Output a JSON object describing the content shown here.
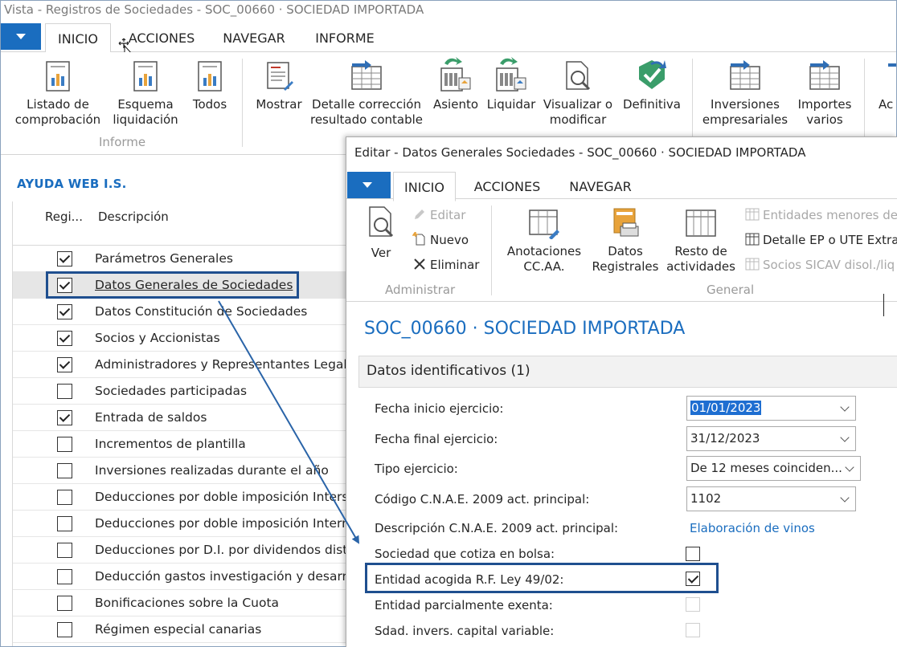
{
  "main_window": {
    "title": "Vista - Registros de Sociedades - SOC_00660 · SOCIEDAD IMPORTADA",
    "tabs": [
      "INICIO",
      "ACCIONES",
      "NAVEGAR",
      "INFORME"
    ],
    "ribbon": {
      "buttons": [
        {
          "label": "Listado de\ncomprobación",
          "icon": "report-chart-icon"
        },
        {
          "label": "Esquema\nliquidación",
          "icon": "report-chart-icon"
        },
        {
          "label": "Todos",
          "icon": "report-chart-icon"
        },
        {
          "label": "Mostrar",
          "icon": "document-edit-icon"
        },
        {
          "label": "Detalle corrección\nresultado contable",
          "icon": "table-arrow-icon"
        },
        {
          "label": "Asiento",
          "icon": "post-document-icon"
        },
        {
          "label": "Liquidar",
          "icon": "post-document-icon"
        },
        {
          "label": "Visualizar o\nmodificar",
          "icon": "preview-document-icon"
        },
        {
          "label": "Definitiva",
          "icon": "green-check-icon"
        },
        {
          "label": "Inversiones\nempresariales",
          "icon": "table-arrow-icon"
        },
        {
          "label": "Importes\nvarios",
          "icon": "table-arrow-icon"
        },
        {
          "label": "Ac",
          "icon": "table-arrow-icon"
        }
      ],
      "group_label": "Informe"
    },
    "section_title": "AYUDA WEB I.S.",
    "list": {
      "columns": [
        "Regi...",
        "Descripción"
      ],
      "rows": [
        {
          "checked": true,
          "label": "Parámetros Generales"
        },
        {
          "checked": true,
          "label": "Datos Generales de Sociedades"
        },
        {
          "checked": true,
          "label": "Datos Constitución de Sociedades"
        },
        {
          "checked": true,
          "label": "Socios y Accionistas"
        },
        {
          "checked": true,
          "label": "Administradores y Representantes Legales"
        },
        {
          "checked": false,
          "label": "Sociedades participadas"
        },
        {
          "checked": true,
          "label": "Entrada de saldos"
        },
        {
          "checked": false,
          "label": "Incrementos de plantilla"
        },
        {
          "checked": false,
          "label": "Inversiones realizadas durante el año"
        },
        {
          "checked": false,
          "label": "Deducciones por doble imposición Intersocietaria"
        },
        {
          "checked": false,
          "label": "Deducciones por doble imposición Internacional"
        },
        {
          "checked": false,
          "label": "Deducciones por D.I. por dividendos distribuidos"
        },
        {
          "checked": false,
          "label": "Deducción gastos investigación y desarrollo"
        },
        {
          "checked": false,
          "label": "Bonificaciones sobre la Cuota"
        },
        {
          "checked": false,
          "label": "Régimen especial canarias"
        }
      ]
    }
  },
  "dialog": {
    "title": "Editar - Datos Generales Sociedades - SOC_00660 · SOCIEDAD IMPORTADA",
    "tabs": [
      "INICIO",
      "ACCIONES",
      "NAVEGAR"
    ],
    "ribbon": {
      "ver": "Ver",
      "editar": "Editar",
      "nuevo": "Nuevo",
      "eliminar": "Eliminar",
      "group_admin": "Administrar",
      "anotaciones": "Anotaciones\nCC.AA.",
      "datos_registrales": "Datos\nRegistrales",
      "resto": "Resto de\nactividades",
      "entidades": "Entidades menores de",
      "detalle_ep": "Detalle EP o UTE Extra",
      "socios_sicav": "Socios SICAV disol./liq",
      "group_general": "General"
    },
    "record_title": "SOC_00660 · SOCIEDAD IMPORTADA",
    "fasttab": "Datos identificativos (1)",
    "fields": {
      "fecha_inicio_label": "Fecha inicio ejercicio:",
      "fecha_inicio_value": "01/01/2023",
      "fecha_final_label": "Fecha final ejercicio:",
      "fecha_final_value": "31/12/2023",
      "tipo_label": "Tipo ejercicio:",
      "tipo_value": "De 12 meses coinciden...",
      "cnae_label": "Código C.N.A.E. 2009 act. principal:",
      "cnae_value": "1102",
      "desc_cnae_label": "Descripción C.N.A.E. 2009 act. principal:",
      "desc_cnae_value": "Elaboración de vinos",
      "cotiza_label": "Sociedad que cotiza en bolsa:",
      "cotiza_checked": false,
      "acogida_label": "Entidad acogida R.F. Ley 49/02:",
      "acogida_checked": true,
      "exenta_label": "Entidad parcialmente exenta:",
      "exenta_checked": false,
      "sicav_label": "Sdad. invers. capital variable:",
      "sicav_checked": false
    }
  },
  "colors": {
    "accent": "#1a6dbf",
    "highlight_box": "#1f4f8f",
    "selection": "#1e6ed1"
  }
}
